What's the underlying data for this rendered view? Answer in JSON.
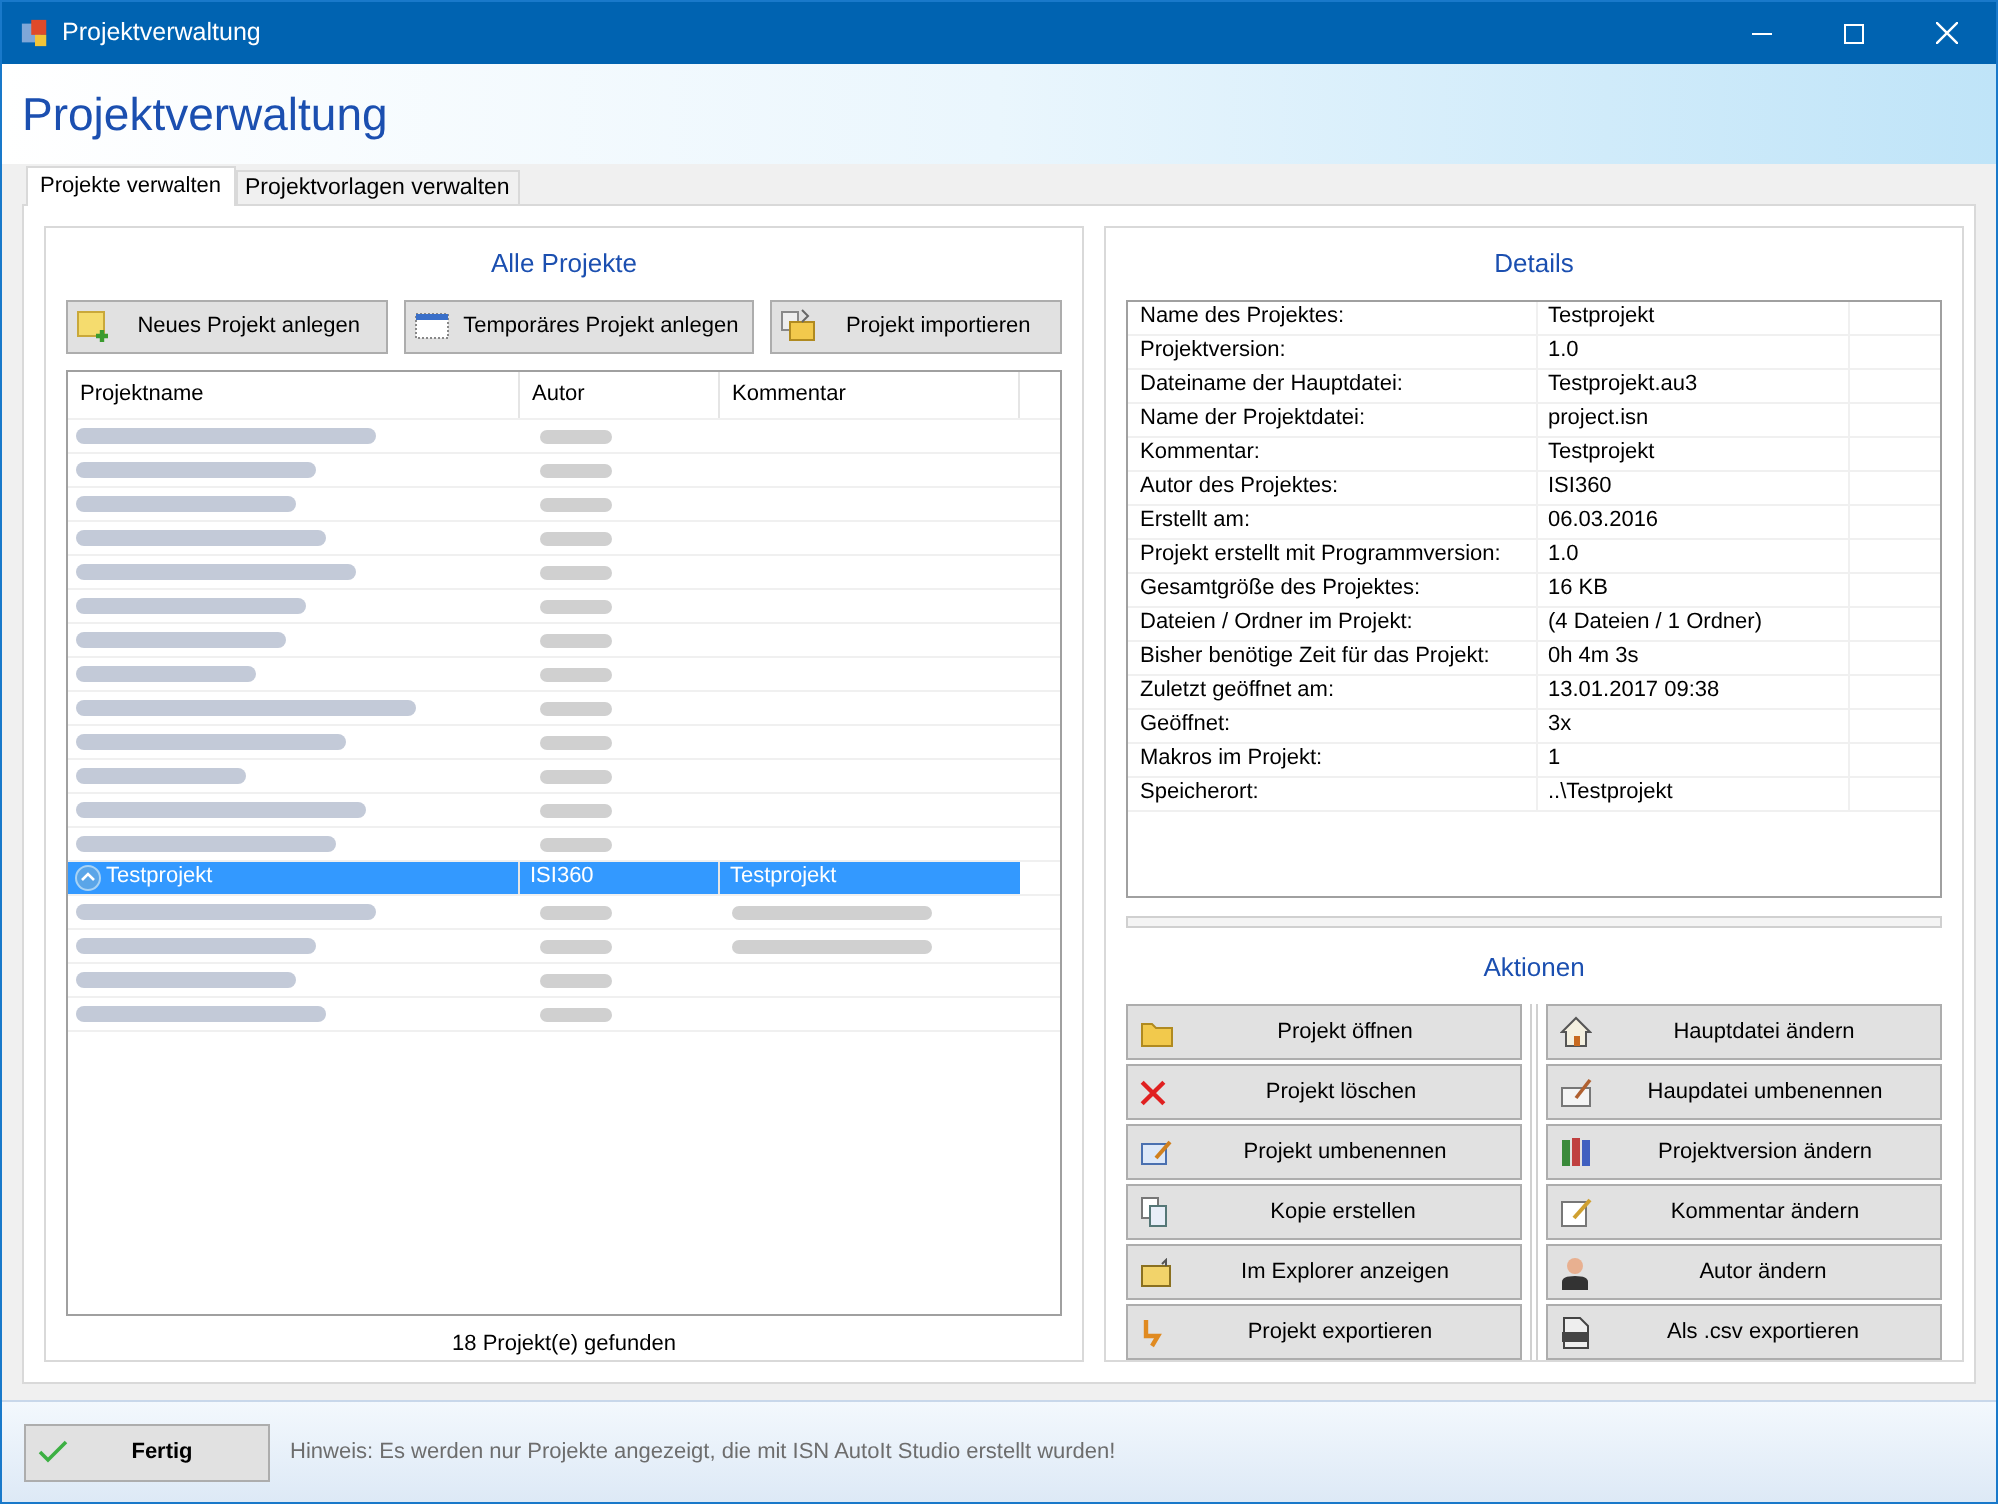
{
  "window": {
    "title": "Projektverwaltung"
  },
  "header": {
    "title": "Projektverwaltung"
  },
  "tabs": [
    {
      "label": "Projekte verwalten",
      "selected": true
    },
    {
      "label": "Projektvorlagen verwalten",
      "selected": false
    }
  ],
  "projects": {
    "title": "Alle Projekte",
    "buttons": [
      "Neues Projekt anlegen",
      "Temporäres Projekt anlegen",
      "Projekt importieren"
    ],
    "columns": [
      "Projektname",
      "Autor",
      "Kommentar"
    ],
    "rows": [
      {
        "kind": "blurred",
        "has_comment": false,
        "selected": false
      },
      {
        "kind": "blurred",
        "has_comment": false,
        "selected": false
      },
      {
        "kind": "blurred",
        "has_comment": false,
        "selected": false
      },
      {
        "kind": "blurred",
        "has_comment": false,
        "selected": false
      },
      {
        "kind": "blurred",
        "has_comment": false,
        "selected": false
      },
      {
        "kind": "blurred",
        "has_comment": false,
        "selected": false
      },
      {
        "kind": "blurred",
        "has_comment": false,
        "selected": false
      },
      {
        "kind": "blurred",
        "has_comment": false,
        "selected": false
      },
      {
        "kind": "blurred",
        "has_comment": false,
        "selected": false
      },
      {
        "kind": "blurred",
        "has_comment": false,
        "selected": false
      },
      {
        "kind": "blurred",
        "has_comment": false,
        "selected": false
      },
      {
        "kind": "blurred",
        "has_comment": false,
        "selected": false
      },
      {
        "kind": "blurred",
        "has_comment": false,
        "selected": false
      },
      {
        "kind": "project",
        "name": "Testprojekt",
        "author": "ISI360",
        "comment": "Testprojekt",
        "selected": true
      },
      {
        "kind": "blurred",
        "has_comment": true,
        "selected": false
      },
      {
        "kind": "blurred",
        "has_comment": true,
        "selected": false
      },
      {
        "kind": "blurred",
        "has_comment": false,
        "selected": false
      },
      {
        "kind": "blurred",
        "has_comment": false,
        "selected": false
      }
    ],
    "footer": "18 Projekt(e) gefunden"
  },
  "details": {
    "title": "Details",
    "rows": [
      [
        "Name des Projektes:",
        "Testprojekt"
      ],
      [
        "Projektversion:",
        "1.0"
      ],
      [
        "Dateiname der Hauptdatei:",
        "Testprojekt.au3"
      ],
      [
        "Name der Projektdatei:",
        "project.isn"
      ],
      [
        "Kommentar:",
        "Testprojekt"
      ],
      [
        "Autor des Projektes:",
        "ISI360"
      ],
      [
        "Erstellt am:",
        "06.03.2016"
      ],
      [
        "Projekt erstellt mit Programmversion:",
        "1.0"
      ],
      [
        "Gesamtgröße des Projektes:",
        "16 KB"
      ],
      [
        "Dateien / Ordner im Projekt:",
        "(4 Dateien / 1 Ordner)"
      ],
      [
        "Bisher benötige Zeit für das Projekt:",
        "0h 4m 3s"
      ],
      [
        "Zuletzt geöffnet am:",
        "13.01.2017 09:38"
      ],
      [
        "Geöffnet:",
        "3x"
      ],
      [
        "Makros im Projekt:",
        "1"
      ],
      [
        "Speicherort:",
        "..\\Testprojekt"
      ]
    ]
  },
  "actions": {
    "title": "Aktionen",
    "left": [
      "Projekt öffnen",
      "Projekt löschen",
      "Projekt umbenennen",
      "Kopie erstellen",
      "Im Explorer anzeigen",
      "Projekt exportieren"
    ],
    "right": [
      "Hauptdatei ändern",
      "Haupdatei umbenennen",
      "Projektversion ändern",
      "Kommentar ändern",
      "Autor ändern",
      "Als .csv exportieren"
    ]
  },
  "bottom": {
    "button": "Fertig",
    "hint": "Hinweis: Es werden nur Projekte angezeigt, die mit ISN AutoIt Studio erstellt wurden!"
  }
}
